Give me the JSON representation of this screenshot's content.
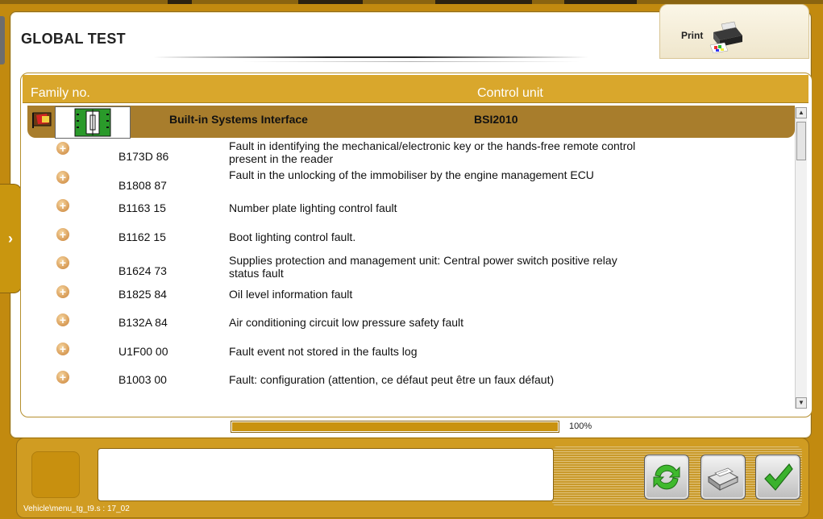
{
  "title": "GLOBAL TEST",
  "print": {
    "label": "Print",
    "icon": "printer-icon"
  },
  "table": {
    "headers": {
      "family": "Family no.",
      "unit": "Control unit"
    },
    "group": {
      "name": "Built-in Systems Interface",
      "code": "BSI2010",
      "icon": "vehicle-flag-icon"
    },
    "rows": [
      {
        "code": "B173D 86",
        "desc": "Fault in identifying the mechanical/electronic key or the hands-free remote control present in the reader"
      },
      {
        "code": "B1808 87",
        "desc": "Fault in the unlocking of the immobiliser by the engine management ECU"
      },
      {
        "code": "B1163 15",
        "desc": "Number plate lighting control fault"
      },
      {
        "code": "B1162 15",
        "desc": "Boot lighting control fault."
      },
      {
        "code": "B1624 73",
        "desc": "Supplies protection and management unit: Central power switch positive relay status fault"
      },
      {
        "code": "B1825 84",
        "desc": "Oil level information fault"
      },
      {
        "code": "B132A 84",
        "desc": "Air conditioning circuit low pressure safety fault"
      },
      {
        "code": "U1F00 00",
        "desc": "Fault event not stored in the faults log"
      },
      {
        "code": "B1003 00",
        "desc": "Fault: configuration (attention, ce défaut peut être un faux défaut)"
      }
    ]
  },
  "progress": {
    "label": "100%",
    "value": 1.0
  },
  "footer": {
    "path": "Vehicle\\menu_tg_t9.s : 17_02"
  },
  "buttons": {
    "refresh": "refresh-icon",
    "print_report": "printer-report-icon",
    "validate": "checkmark-icon"
  },
  "colors": {
    "accent": "#c9920f",
    "header": "#d9a72c",
    "group": "#a87d2c"
  }
}
